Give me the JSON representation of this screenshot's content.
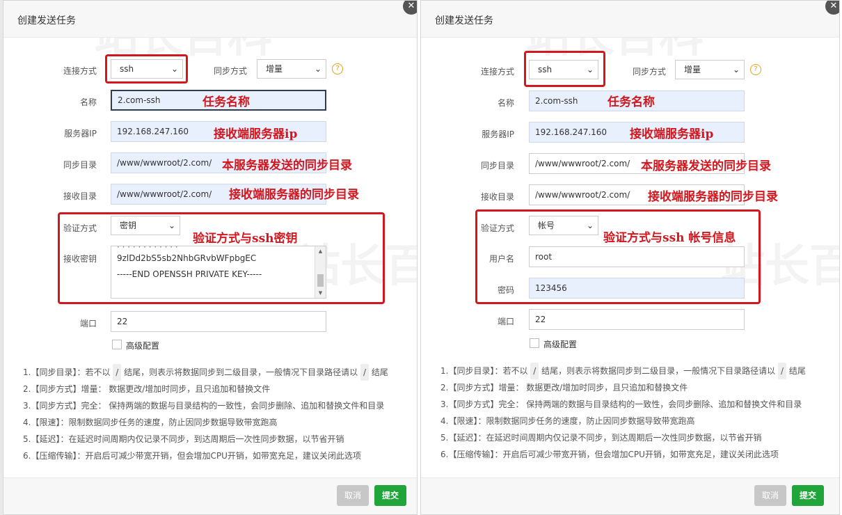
{
  "left": {
    "title": "创建发送任务",
    "close_glyph": "✕",
    "connect_label": "连接方式",
    "connect_value": "ssh",
    "sync_mode_label": "同步方式",
    "sync_mode_value": "增量",
    "help_glyph": "?",
    "name_label": "名称",
    "name_value": "2.com-ssh",
    "ip_label": "服务器IP",
    "ip_value": "192.168.247.160",
    "sync_dir_label": "同步目录",
    "sync_dir_value": "/www/wwwroot/2.com/",
    "recv_dir_label": "接收目录",
    "recv_dir_value": "/www/wwwroot/2.com/",
    "auth_label": "验证方式",
    "auth_value": "密钥",
    "key_label": "接收密钥",
    "key_lines": [
      "9zlDd2bS5sb2NhbGRvbWFpbgEC",
      "-----END OPENSSH PRIVATE KEY-----"
    ],
    "port_label": "端口",
    "port_value": "22",
    "advanced_label": "高级配置",
    "annotations": {
      "name": "任务名称",
      "ip": "接收端服务器ip",
      "sync_dir": "本服务器发送的同步目录",
      "recv_dir": "接收端服务器的同步目录",
      "auth": "验证方式与ssh密钥"
    },
    "cancel_label": "取消",
    "submit_label": "提交"
  },
  "right": {
    "title": "创建发送任务",
    "close_glyph": "✕",
    "connect_label": "连接方式",
    "connect_value": "ssh",
    "sync_mode_label": "同步方式",
    "sync_mode_value": "增量",
    "help_glyph": "?",
    "name_label": "名称",
    "name_value": "2.com-ssh",
    "ip_label": "服务器IP",
    "ip_value": "192.168.247.160",
    "sync_dir_label": "同步目录",
    "sync_dir_value": "/www/wwwroot/2.com/",
    "recv_dir_label": "接收目录",
    "recv_dir_value": "/www/wwwroot/2.com/",
    "auth_label": "验证方式",
    "auth_value": "帐号",
    "user_label": "用户名",
    "user_value": "root",
    "pass_label": "密码",
    "pass_value": "123456",
    "port_label": "端口",
    "port_value": "22",
    "advanced_label": "高级配置",
    "annotations": {
      "name": "任务名称",
      "ip": "接收端服务器ip",
      "sync_dir": "本服务器发送的同步目录",
      "recv_dir": "接收端服务器的同步目录",
      "auth": "验证方式与ssh 帐号信息"
    },
    "cancel_label": "取消",
    "submit_label": "提交"
  },
  "notes": {
    "n1a": "1.【同步目录】：若不以",
    "n1b": "结尾，则表示将数据同步到二级目录，一般情况下目录路径请以",
    "n1c": "结尾",
    "slash": "/",
    "n2": "2.【同步方式】增量： 数据更改/增加时同步，且只追加和替换文件",
    "n3": "3.【同步方式】完全： 保持两端的数据与目录结构的一致性，会同步删除、追加和替换文件和目录",
    "n4": "4.【限速】：限制数据同步任务的速度，防止因同步数据导致带宽跑高",
    "n5": "5.【延迟】：在延迟时间周期内仅记录不同步，到达周期后一次性同步数据，以节省开销",
    "n6": "6.【压缩传输】：开启后可减少带宽开销，但会增加CPU开销，如带宽充足，建议关闭此选项"
  },
  "watermark": "站长百科"
}
